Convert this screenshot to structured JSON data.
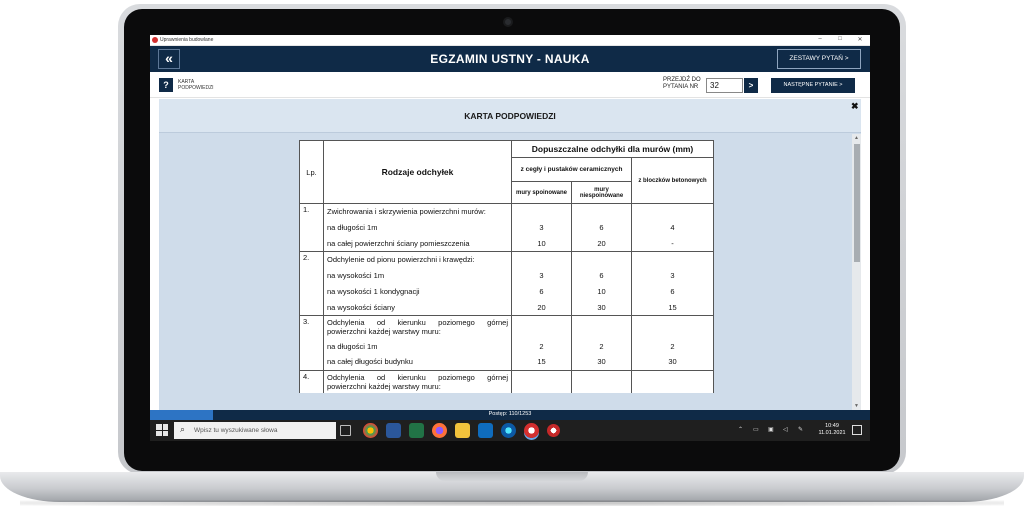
{
  "window": {
    "title": "Uprawnienia budowlane",
    "minimize": "–",
    "maximize": "□",
    "close": "✕"
  },
  "header": {
    "back_label": "«",
    "title": "EGZAMIN USTNY - NAUKA",
    "sets_button": "ZESTAWY PYTAŃ  >"
  },
  "toolbar": {
    "help_icon": "?",
    "hint_label": "KARTA PODPOWIEDZI",
    "goto_label": "PRZEJDŹ DO PYTANIA NR",
    "goto_value": "32",
    "goto_button": ">",
    "next_button": "NASTĘPNE PYTANIE  >"
  },
  "card": {
    "title": "KARTA PODPOWIEDZI",
    "close": "✖"
  },
  "table": {
    "head_lp": "Lp.",
    "head_type": "Rodzaje odchyłek",
    "head_allowed": "Dopuszczalne odchyłki dla murów (mm)",
    "head_brick": "z cegły i pustaków ceramicznych",
    "head_block": "z bloczków betonowych",
    "head_mortared": "mury spoinowane",
    "head_unmortared": "mury niespoinowane",
    "groups": [
      {
        "lp": "1.",
        "title": "Zwichrowania i skrzywienia powierzchni murów:",
        "rows": [
          {
            "label": "na długości 1m",
            "a": "3",
            "b": "6",
            "c": "4"
          },
          {
            "label": "na całej powierzchni ściany pomieszczenia",
            "a": "10",
            "b": "20",
            "c": "-"
          }
        ]
      },
      {
        "lp": "2.",
        "title": "Odchylenie od pionu powierzchni i krawędzi:",
        "rows": [
          {
            "label": "na wysokości 1m",
            "a": "3",
            "b": "6",
            "c": "3"
          },
          {
            "label": "na wysokości 1 kondygnacji",
            "a": "6",
            "b": "10",
            "c": "6"
          },
          {
            "label": "na wysokości ściany",
            "a": "20",
            "b": "30",
            "c": "15"
          }
        ]
      },
      {
        "lp": "3.",
        "title": "Odchylenia od kierunku poziomego górnej powierzchni każdej warstwy muru:",
        "rows": [
          {
            "label": "na długości 1m",
            "a": "2",
            "b": "2",
            "c": "2"
          },
          {
            "label": "na całej długości budynku",
            "a": "15",
            "b": "30",
            "c": "30"
          }
        ]
      },
      {
        "lp": "4.",
        "title": "Odchylenia od kierunku poziomego górnej powierzchni każdej warstwy muru:",
        "rows": []
      }
    ]
  },
  "progress": {
    "text": "Postęp: 110/1253",
    "fraction": 0.0878
  },
  "taskbar": {
    "search_placeholder": "Wpisz tu wyszukiwane słowa",
    "time": "10:49",
    "date": "11.01.2021"
  },
  "colors": {
    "header_bg": "#0f2a47",
    "content_bg": "#cfdcea",
    "progress_fill": "#2d74c4"
  }
}
